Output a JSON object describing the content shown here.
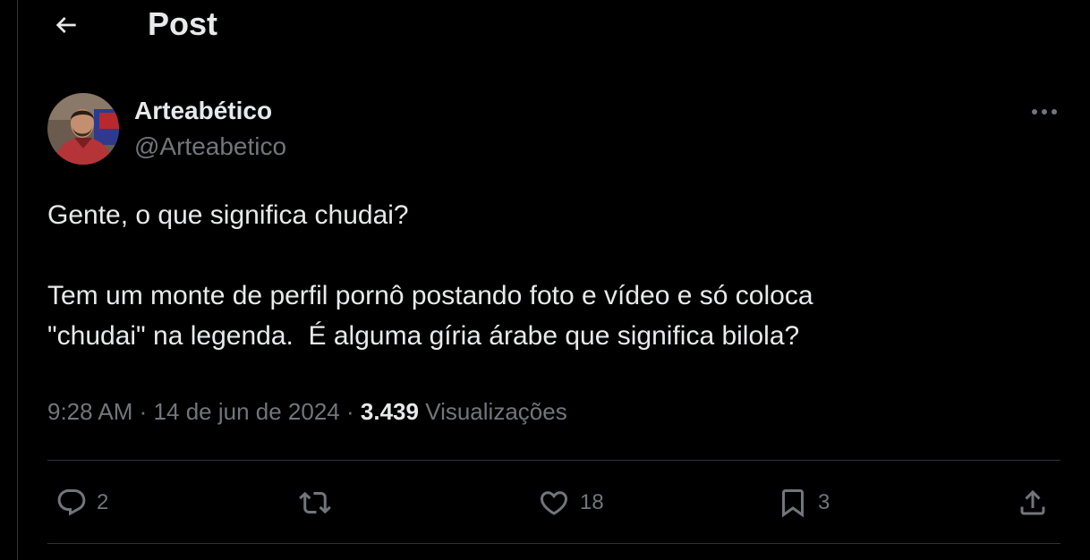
{
  "header": {
    "back_icon": "arrow-left-icon",
    "title": "Post"
  },
  "author": {
    "display_name": "Arteabético",
    "handle": "@Arteabetico",
    "avatar_icon": "user-photo-avatar"
  },
  "post": {
    "lines": [
      "Gente, o que significa chudai?",
      "",
      "Tem um monte de perfil pornô postando foto e vídeo e só coloca",
      "\"chudai\" na legenda.  É alguma gíria árabe que significa bilola?"
    ],
    "time": "9:28 AM",
    "separator": "·",
    "date": "14 de jun de 2024",
    "views_count": "3.439",
    "views_label": "Visualizações"
  },
  "actions": {
    "reply": {
      "icon": "reply-icon",
      "count": "2"
    },
    "repost": {
      "icon": "repost-icon",
      "count": ""
    },
    "like": {
      "icon": "heart-icon",
      "count": "18"
    },
    "bookmark": {
      "icon": "bookmark-icon",
      "count": "3"
    },
    "share": {
      "icon": "share-icon",
      "count": ""
    }
  },
  "colors": {
    "background": "#000000",
    "primary_text": "#e7e9ea",
    "secondary_text": "#71767b",
    "border": "#2f3336"
  }
}
